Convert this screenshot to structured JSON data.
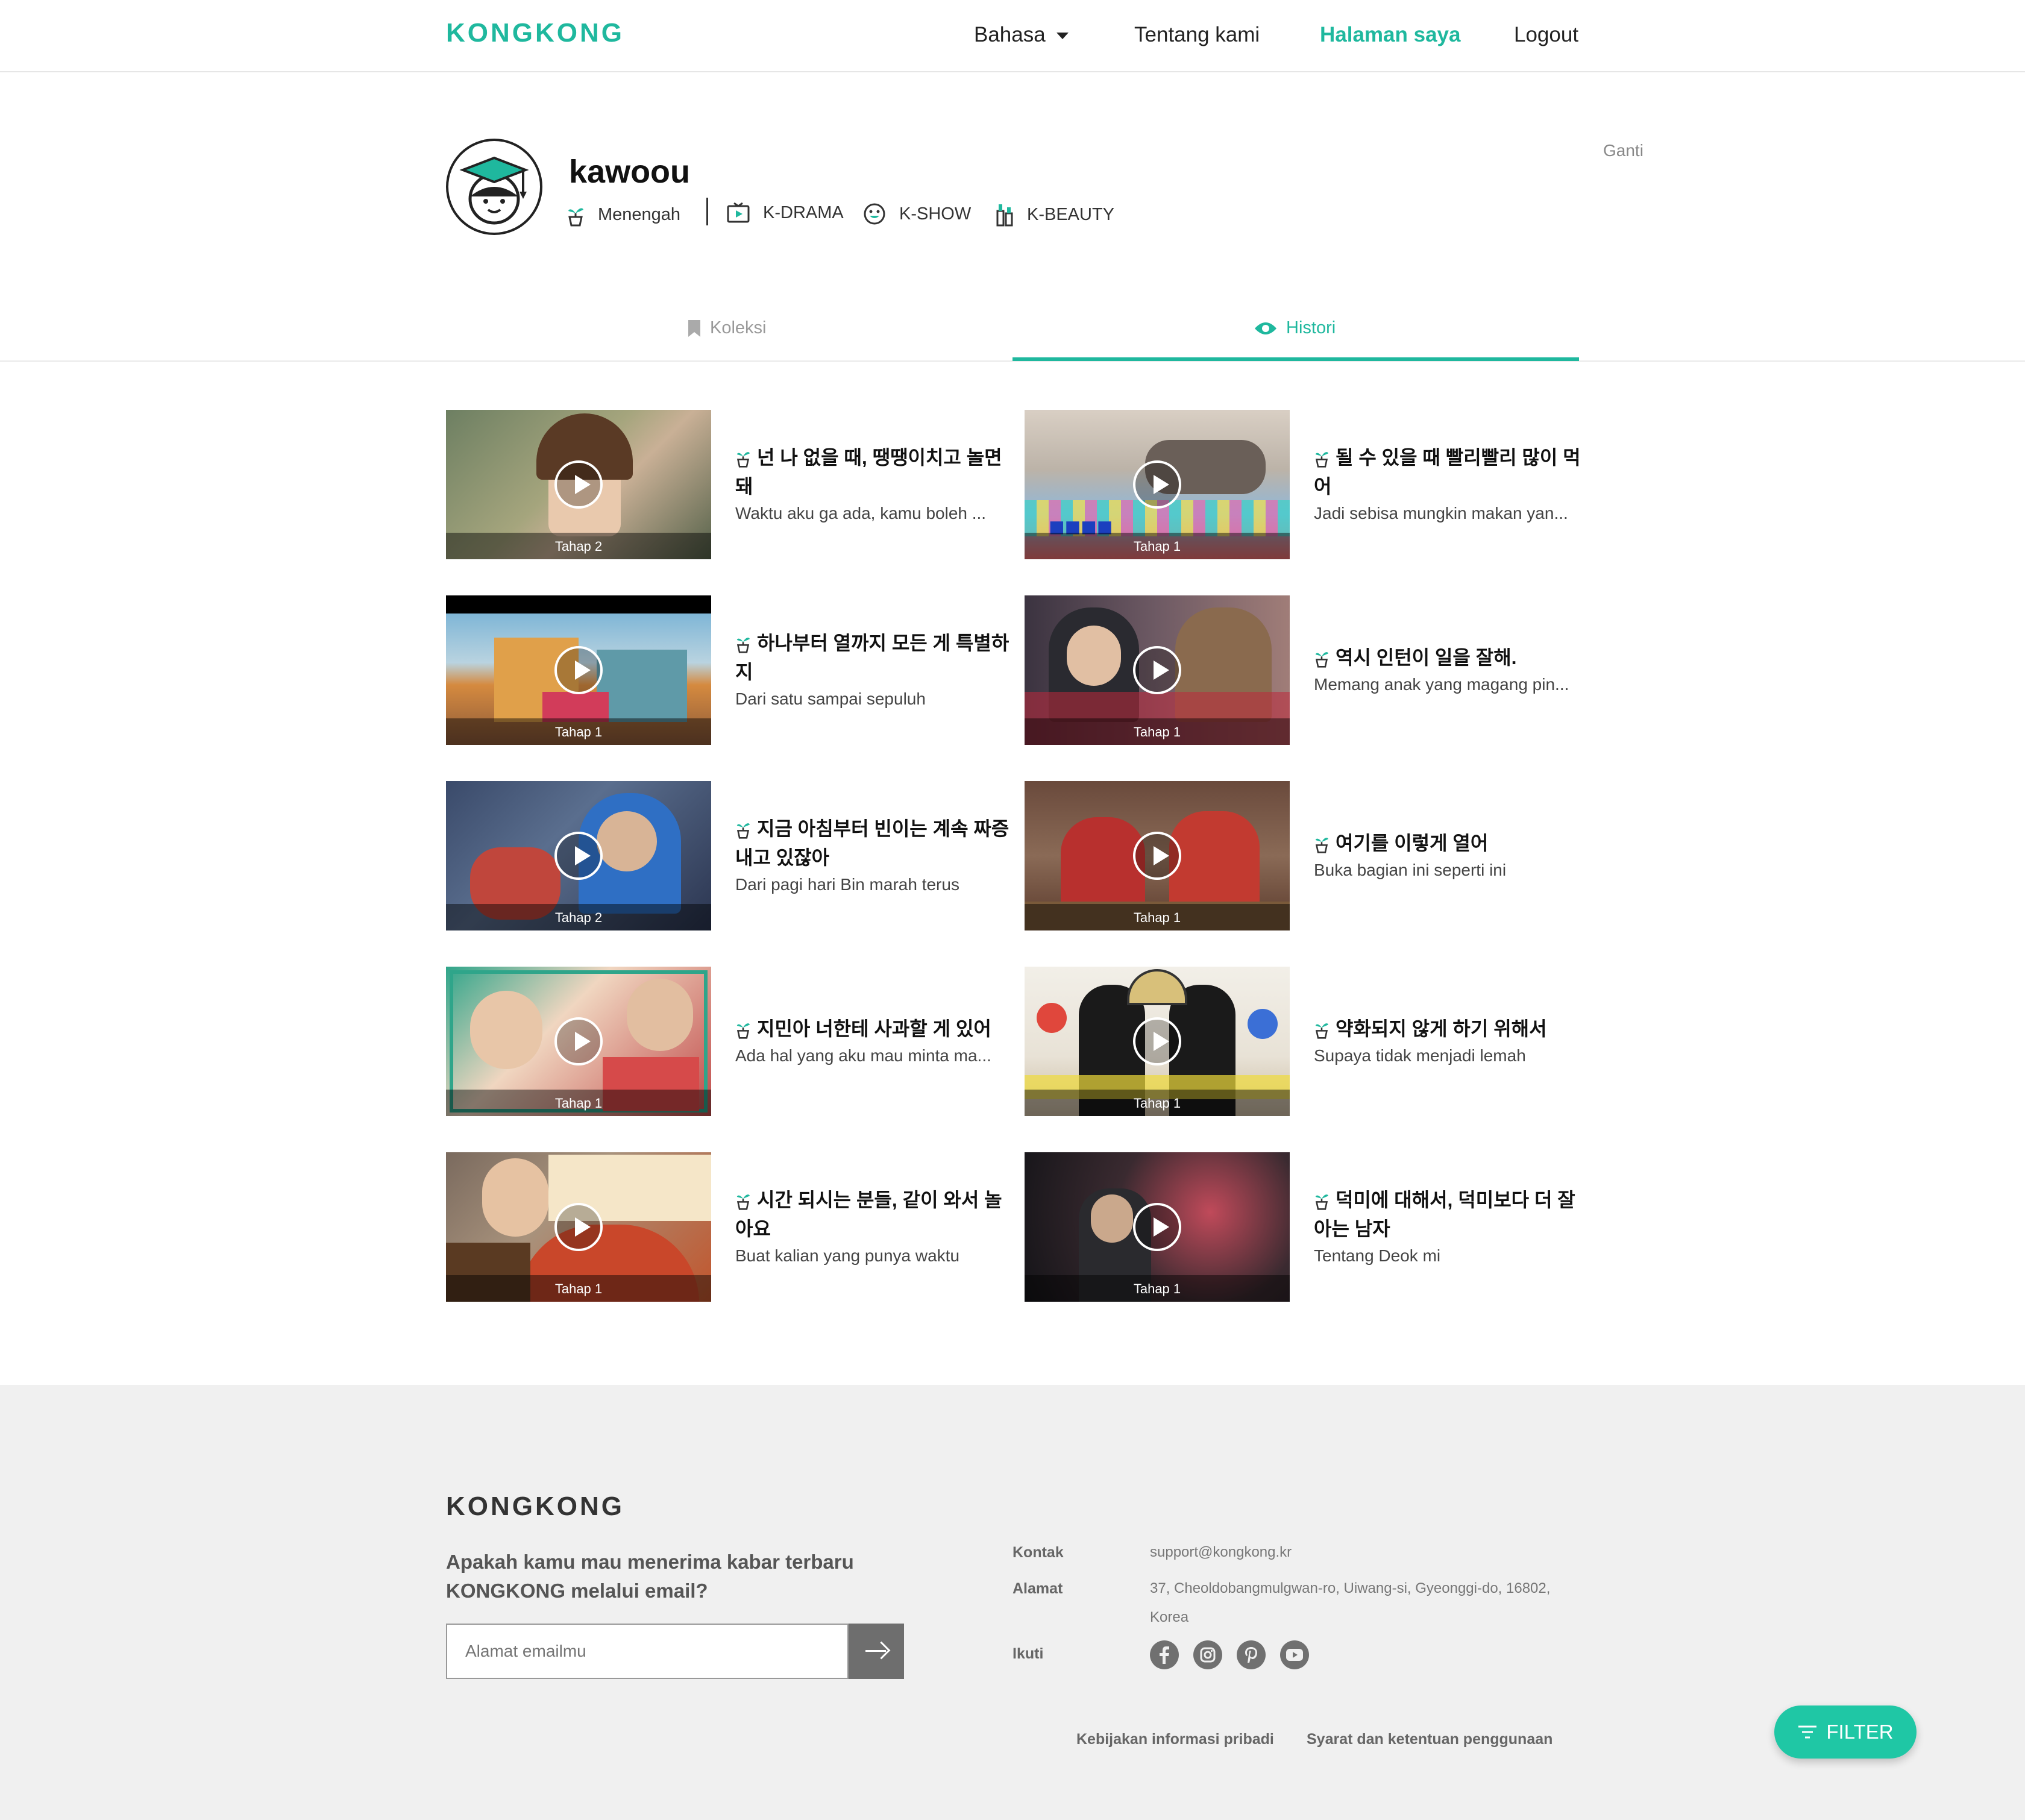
{
  "header": {
    "logo": "KONGKONG",
    "nav": {
      "language": "Bahasa",
      "about": "Tentang kami",
      "my_page": "Halaman saya",
      "logout": "Logout"
    }
  },
  "profile": {
    "username": "kawoou",
    "level": "Menengah",
    "interests": [
      "K-DRAMA",
      "K-SHOW",
      "K-BEAUTY"
    ],
    "change_label": "Ganti"
  },
  "tabs": {
    "collection": "Koleksi",
    "history": "Histori",
    "active": "history"
  },
  "history": [
    {
      "title": "넌 나 없을 때, 땡땡이치고 놀면 돼",
      "subtitle": "Waktu aku ga ada, kamu boleh ...",
      "stage": "Tahap 2"
    },
    {
      "title": "될 수 있을 때 빨리빨리 많이 먹어",
      "subtitle": "Jadi sebisa mungkin makan yan...",
      "stage": "Tahap 1"
    },
    {
      "title": "하나부터 열까지 모든 게 특별하지",
      "subtitle": "Dari satu sampai sepuluh",
      "stage": "Tahap 1"
    },
    {
      "title": "역시 인턴이 일을 잘해.",
      "subtitle": "Memang anak yang magang pin...",
      "stage": "Tahap 1"
    },
    {
      "title": "지금 아침부터 빈이는 계속 짜증내고 있잖아",
      "subtitle": "Dari pagi hari Bin marah terus",
      "stage": "Tahap 2"
    },
    {
      "title": "여기를 이렇게 열어",
      "subtitle": "Buka bagian ini seperti ini",
      "stage": "Tahap 1"
    },
    {
      "title": "지민아 너한테 사과할 게 있어",
      "subtitle": "Ada hal yang aku mau minta ma...",
      "stage": "Tahap 1"
    },
    {
      "title": "약화되지 않게 하기 위해서",
      "subtitle": "Supaya tidak menjadi lemah",
      "stage": "Tahap 1"
    },
    {
      "title": "시간 되시는 분들, 같이 와서 놀아요",
      "subtitle": "Buat kalian yang punya waktu",
      "stage": "Tahap 1"
    },
    {
      "title": "덕미에 대해서, 덕미보다 더 잘 아는 남자",
      "subtitle": "Tentang Deok mi",
      "stage": "Tahap 1"
    }
  ],
  "footer": {
    "logo": "KONGKONG",
    "newsletter_text": "Apakah kamu mau menerima kabar terbaru KONGKONG melalui email?",
    "email_placeholder": "Alamat emailmu",
    "contact_label": "Kontak",
    "contact_value": "support@kongkong.kr",
    "address_label": "Alamat",
    "address_value": "37, Cheoldobangmulgwan-ro, Uiwang-si, Gyeonggi-do, 16802, Korea",
    "follow_label": "Ikuti",
    "social": [
      "facebook-icon",
      "instagram-icon",
      "pinterest-icon",
      "youtube-icon"
    ],
    "privacy": "Kebijakan informasi pribadi",
    "terms": "Syarat dan ketentuan penggunaan"
  },
  "filter_button": "FILTER",
  "colors": {
    "accent": "#1fb89e",
    "filter": "#1fc7a5",
    "footer_bg": "#f0f0f0"
  }
}
